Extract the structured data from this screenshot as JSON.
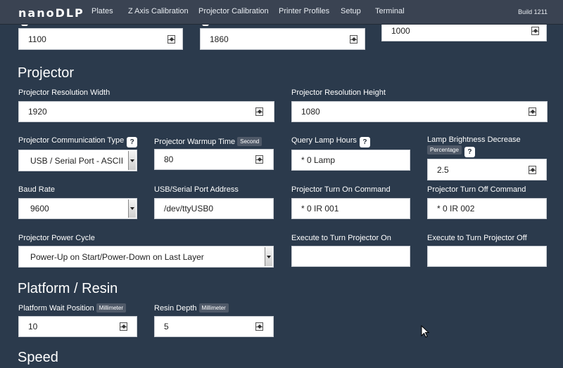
{
  "nav": {
    "brand": "nanoDLP",
    "items": [
      "Plates",
      "Z Axis Calibration",
      "Projector Calibration",
      "Printer Profiles",
      "Setup",
      "Terminal"
    ],
    "build": "Build 1211"
  },
  "top_fields": [
    "1100",
    "1860",
    "1000"
  ],
  "projector": {
    "title": "Projector",
    "res_width_label": "Projector Resolution Width",
    "res_width": "1920",
    "res_height_label": "Projector Resolution Height",
    "res_height": "1080",
    "comm_type_label": "Projector Communication Type",
    "comm_type": "USB / Serial Port - ASCII",
    "warmup_label": "Projector Warmup Time",
    "warmup_badge": "Second",
    "warmup": "80",
    "lamp_hours_label": "Query Lamp Hours",
    "lamp_hours": "* 0 Lamp",
    "lamp_brightness_label": "Lamp Brightness Decrease",
    "lamp_brightness_badge": "Percentage",
    "lamp_brightness": "2.5",
    "baud_label": "Baud Rate",
    "baud": "9600",
    "port_label": "USB/Serial Port Address",
    "port": "/dev/ttyUSB0",
    "turn_on_label": "Projector Turn On Command",
    "turn_on": "* 0 IR 001",
    "turn_off_label": "Projector Turn Off Command",
    "turn_off": "* 0 IR 002",
    "power_cycle_label": "Projector Power Cycle",
    "power_cycle": "Power-Up on Start/Power-Down on Last Layer",
    "exec_on_label": "Execute to Turn Projector On",
    "exec_on": "",
    "exec_off_label": "Execute to Turn Projector Off",
    "exec_off": "",
    "help_glyph": "?"
  },
  "platform": {
    "title": "Platform / Resin",
    "wait_label": "Platform Wait Position",
    "wait_badge": "Millimeter",
    "wait": "10",
    "depth_label": "Resin Depth",
    "depth_badge": "Millimeter",
    "depth": "5"
  },
  "speed": {
    "title": "Speed"
  }
}
